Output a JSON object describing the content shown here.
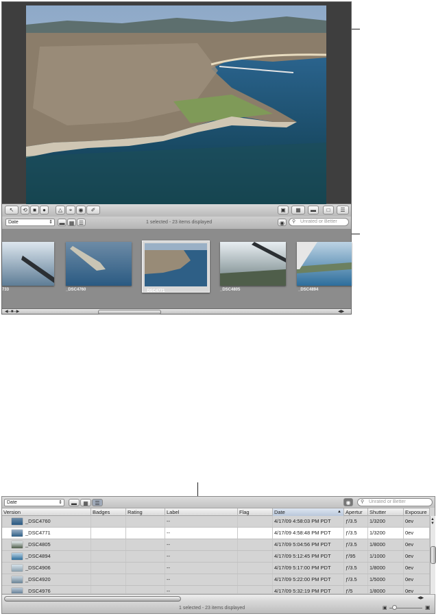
{
  "browser": {
    "sort_value": "Date",
    "status_text": "1 selected - 23 items displayed",
    "search_placeholder": "Unrated or Better",
    "filmstrip": [
      {
        "label": "733"
      },
      {
        "label": "_DSC4760"
      },
      {
        "label": "_DSC4771",
        "selected": true
      },
      {
        "label": "_DSC4805"
      },
      {
        "label": "_DSC4894"
      }
    ]
  },
  "list": {
    "sort_value": "Date",
    "search_placeholder": "Unrated or Better",
    "status_text": "1 selected - 23 items displayed",
    "columns": [
      "Version",
      "Badges",
      "Rating",
      "Label",
      "Flag",
      "Date",
      "Apertur",
      "Shutter",
      "Exposure"
    ],
    "rows": [
      {
        "version": "_DSC4760",
        "label": "--",
        "date": "4/17/09 4:58:03 PM PDT",
        "aperture": "ƒ/3.5",
        "shutter": "1/3200",
        "exposure": "0ev"
      },
      {
        "version": "_DSC4771",
        "label": "--",
        "date": "4/17/09 4:58:48 PM PDT",
        "aperture": "ƒ/3.5",
        "shutter": "1/3200",
        "exposure": "0ev",
        "selected": true
      },
      {
        "version": "_DSC4805",
        "label": "--",
        "date": "4/17/09 5:04:56 PM PDT",
        "aperture": "ƒ/3.5",
        "shutter": "1/8000",
        "exposure": "0ev"
      },
      {
        "version": "_DSC4894",
        "label": "--",
        "date": "4/17/09 5:12:45 PM PDT",
        "aperture": "ƒ/95",
        "shutter": "1/1000",
        "exposure": "0ev"
      },
      {
        "version": "_DSC4906",
        "label": "--",
        "date": "4/17/09 5:17:00 PM PDT",
        "aperture": "ƒ/3.5",
        "shutter": "1/8000",
        "exposure": "0ev"
      },
      {
        "version": "_DSC4920",
        "label": "--",
        "date": "4/17/09 5:22:00 PM PDT",
        "aperture": "ƒ/3.5",
        "shutter": "1/5000",
        "exposure": "0ev"
      },
      {
        "version": "_DSC4976",
        "label": "--",
        "date": "4/17/09 5:32:19 PM PDT",
        "aperture": "ƒ/5",
        "shutter": "1/8000",
        "exposure": "0ev"
      }
    ]
  },
  "icons": {
    "toolbar_tools": [
      "pointer-icon",
      "rotate-left-icon",
      "stamp-icon",
      "lift-icon",
      "straighten-icon",
      "crop-icon",
      "red-eye-icon",
      "brush-icon"
    ],
    "toolbar_right": [
      "full-screen-icon",
      "share-icon",
      "filmstrip-toggle-icon",
      "inspector-icon",
      "hud-icon"
    ]
  },
  "colors": {
    "viewer_bg": "#3e3e3e",
    "filmstrip_bg": "#8c8c8c",
    "selected_row": "#ffffff",
    "row_bg": "#d4d4d4",
    "sorted_header": "#c8d4e4"
  }
}
